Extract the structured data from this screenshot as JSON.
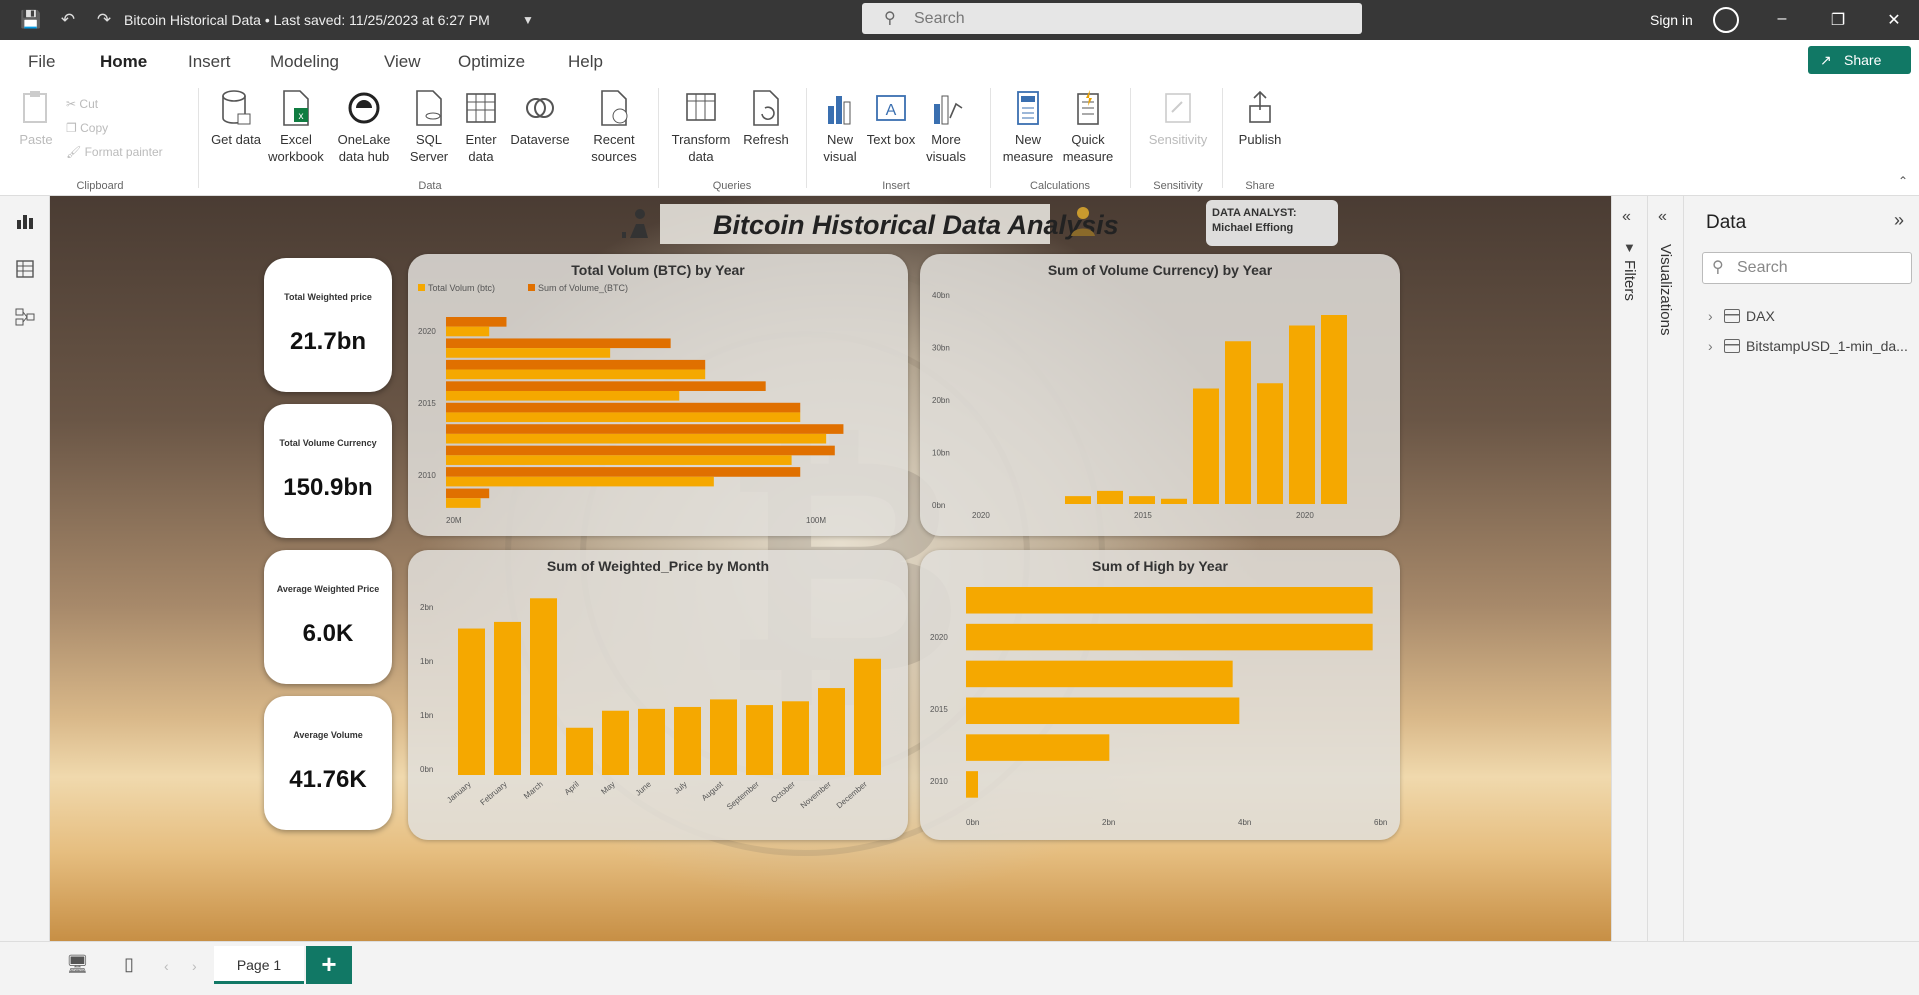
{
  "titlebar": {
    "doc_title": "Bitcoin Historical Data • Last saved: 11/25/2023 at 6:27 PM",
    "search_placeholder": "Search",
    "sign_in": "Sign in"
  },
  "menu": {
    "items": [
      "File",
      "Home",
      "Insert",
      "Modeling",
      "View",
      "Optimize",
      "Help"
    ],
    "active": "Home",
    "share": "Share"
  },
  "ribbon": {
    "clipboard": {
      "paste": "Paste",
      "cut": "Cut",
      "copy": "Copy",
      "format_painter": "Format painter",
      "group": "Clipboard"
    },
    "data": {
      "get_data": "Get data",
      "excel": "Excel workbook",
      "onelake": "OneLake data hub",
      "sql": "SQL Server",
      "enter": "Enter data",
      "dataverse": "Dataverse",
      "recent": "Recent sources",
      "group": "Data"
    },
    "queries": {
      "transform": "Transform data",
      "refresh": "Refresh",
      "group": "Queries"
    },
    "insert": {
      "new_visual": "New visual",
      "text_box": "Text box",
      "more_visuals": "More visuals",
      "group": "Insert"
    },
    "calculations": {
      "new_measure": "New measure",
      "quick_measure": "Quick measure",
      "group": "Calculations"
    },
    "sensitivity": {
      "label": "Sensitivity",
      "group": "Sensitivity"
    },
    "share": {
      "publish": "Publish",
      "group": "Share"
    }
  },
  "report": {
    "title": "Bitcoin Historical Data Analysis",
    "analyst_label": "DATA ANALYST:",
    "analyst_name": "Michael Effiong"
  },
  "kpis": [
    {
      "label": "Total Weighted price",
      "value": "21.7bn"
    },
    {
      "label": "Total Volume Currency",
      "value": "150.9bn"
    },
    {
      "label": "Average Weighted Price",
      "value": "6.0K"
    },
    {
      "label": "Average Volume",
      "value": "41.76K"
    }
  ],
  "chart_data": [
    {
      "type": "bar",
      "orientation": "horizontal",
      "title": "Total Volum (BTC) by Year",
      "legend": [
        "Total Volum (btc)",
        "Sum of Volume_(BTC)"
      ],
      "legend_position": "top-left",
      "colors": [
        "#f5a800",
        "#e07000"
      ],
      "y_ticks": [
        "2020",
        "2015",
        "2010"
      ],
      "x_ticks": [
        "20M",
        "",
        "100M"
      ],
      "xlim": [
        0,
        100
      ],
      "series": [
        {
          "name": "Total Volum (btc)",
          "values": [
            10,
            38,
            60,
            54,
            82,
            88,
            80,
            62,
            8
          ]
        },
        {
          "name": "Sum of Volume_(BTC)",
          "values": [
            14,
            52,
            60,
            74,
            82,
            92,
            90,
            82,
            10
          ]
        }
      ]
    },
    {
      "type": "bar",
      "title": "Sum of Volume Currency) by Year",
      "y_ticks": [
        "40bn",
        "30bn",
        "20bn",
        "10bn",
        "0bn"
      ],
      "x_ticks": [
        "2020",
        "2015",
        "2020"
      ],
      "ylim": [
        0,
        40
      ],
      "color": "#f5a800",
      "values": [
        1.5,
        2.5,
        1.5,
        1,
        22,
        31,
        23,
        34,
        36
      ]
    },
    {
      "type": "bar",
      "title": "Sum of Weighted_Price by Month",
      "categories": [
        "January",
        "February",
        "March",
        "April",
        "May",
        "June",
        "July",
        "August",
        "September",
        "October",
        "November",
        "December"
      ],
      "y_ticks": [
        "2bn",
        "1bn",
        "1bn",
        "0bn"
      ],
      "ylim": [
        0,
        2
      ],
      "color": "#f5a800",
      "values": [
        1.55,
        1.62,
        1.87,
        0.5,
        0.68,
        0.7,
        0.72,
        0.8,
        0.74,
        0.78,
        0.92,
        1.23
      ]
    },
    {
      "type": "bar",
      "orientation": "horizontal",
      "title": "Sum of High by Year",
      "y_ticks": [
        "2020",
        "2015",
        "2010"
      ],
      "x_ticks": [
        "0bn",
        "2bn",
        "4bn",
        "6bn"
      ],
      "xlim": [
        0,
        6
      ],
      "color": "#f5a800",
      "values": [
        6.1,
        6.1,
        4.0,
        4.1,
        2.15,
        0.18
      ]
    }
  ],
  "panes": {
    "filters": "Filters",
    "visualizations": "Visualizations",
    "data_title": "Data",
    "data_search": "Search",
    "tree": [
      "DAX",
      "BitstampUSD_1-min_da..."
    ]
  },
  "footer": {
    "page_tab": "Page 1",
    "add_page": "+"
  }
}
